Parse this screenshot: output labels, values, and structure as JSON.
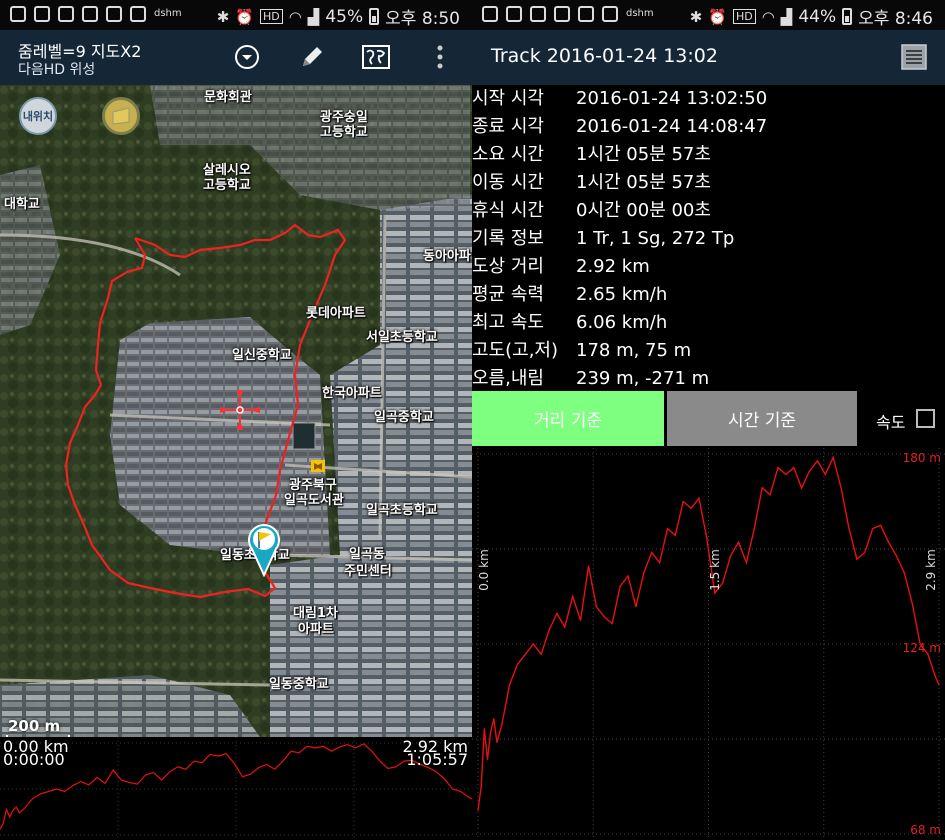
{
  "left_status": {
    "battery": "45%",
    "time": "오후 8:50",
    "carrier": "dshm",
    "net": "HD"
  },
  "right_status": {
    "battery": "44%",
    "time": "오후 8:46",
    "carrier": "dshm",
    "net": "HD"
  },
  "left_actionbar": {
    "line1": "줌레벨=9 지도X2",
    "line2": "다음HD 위성"
  },
  "map": {
    "my_location_label": "내위치",
    "labels": [
      "문화회관",
      "광주숭일",
      "고등학교",
      "살레시오",
      "고등학교",
      "대학교",
      "동아아파",
      "롯데아파트",
      "서일초등학교",
      "일신중학교",
      "한국아파트",
      "일곡중학교",
      "광주북구",
      "일곡도서관",
      "일곡초등학교",
      "일곡동",
      "주민센터",
      "일동초",
      "학교",
      "대림1차",
      "아파트",
      "일동중학교"
    ],
    "scale": "200 m"
  },
  "mini_profile": {
    "start_dist": "0.00 km",
    "start_time": "0:00:00",
    "end_dist": "2.92 km",
    "end_time": "1:05:57"
  },
  "track_title": "Track 2016-01-24 13:02",
  "track_info": [
    {
      "key": "시작 시각",
      "value": "2016-01-24 13:02:50"
    },
    {
      "key": "종료 시각",
      "value": "2016-01-24 14:08:47"
    },
    {
      "key": "소요 시간",
      "value": "1시간 05분 57초"
    },
    {
      "key": "이동 시간",
      "value": "1시간 05분 57초"
    },
    {
      "key": "휴식 시간",
      "value": "0시간 00분 00초"
    },
    {
      "key": "기록 정보",
      "value": "1 Tr, 1 Sg, 272 Tp"
    },
    {
      "key": "도상 거리",
      "value": "2.92 km"
    },
    {
      "key": "평균 속력",
      "value": "2.65 km/h"
    },
    {
      "key": "최고 속도",
      "value": "6.06 km/h"
    },
    {
      "key": "고도(고,저)",
      "value": "178 m, 75 m"
    },
    {
      "key": "오름,내림",
      "value": "239 m, -271 m"
    }
  ],
  "buttons": {
    "distance": "거리 기준",
    "time": "시간 기준",
    "speed_label": "속도"
  },
  "chart_data": {
    "type": "line",
    "title": "",
    "xlabel": "",
    "ylabel": "",
    "x_ticks": [
      "0.0 km",
      "1.5 km",
      "2.9 km"
    ],
    "y_ticks": [
      "180 m",
      "124 m",
      "68 m"
    ],
    "xlim": [
      0,
      2.92
    ],
    "ylim": [
      68,
      180
    ],
    "grid": true,
    "series": [
      {
        "color": "#ff2020",
        "x": [
          0.0,
          0.02,
          0.04,
          0.06,
          0.08,
          0.1,
          0.12,
          0.15,
          0.2,
          0.25,
          0.3,
          0.35,
          0.4,
          0.45,
          0.5,
          0.55,
          0.6,
          0.65,
          0.7,
          0.75,
          0.8,
          0.85,
          0.9,
          0.95,
          1.0,
          1.05,
          1.1,
          1.15,
          1.2,
          1.25,
          1.3,
          1.35,
          1.4,
          1.45,
          1.5,
          1.55,
          1.6,
          1.65,
          1.7,
          1.75,
          1.8,
          1.85,
          1.9,
          1.95,
          2.0,
          2.05,
          2.1,
          2.15,
          2.2,
          2.25,
          2.3,
          2.35,
          2.4,
          2.45,
          2.5,
          2.55,
          2.6,
          2.65,
          2.7,
          2.75,
          2.8,
          2.85,
          2.9,
          2.92
        ],
        "y": [
          75,
          82,
          99,
          90,
          98,
          102,
          95,
          100,
          112,
          118,
          121,
          124,
          121,
          128,
          133,
          129,
          138,
          131,
          147,
          135,
          132,
          130,
          141,
          144,
          135,
          145,
          151,
          148,
          158,
          156,
          166,
          164,
          167,
          155,
          139,
          142,
          150,
          154,
          148,
          158,
          170,
          168,
          176,
          174,
          176,
          170,
          175,
          178,
          174,
          179,
          170,
          158,
          149,
          151,
          158,
          159,
          154,
          150,
          145,
          136,
          124,
          121,
          114,
          112
        ]
      }
    ]
  },
  "colors": {
    "actionbar": "#152737",
    "dist_button": "#7fff7f",
    "time_button": "#8a8a8a",
    "track": "#ff2020",
    "elev_line": "#e81010"
  }
}
